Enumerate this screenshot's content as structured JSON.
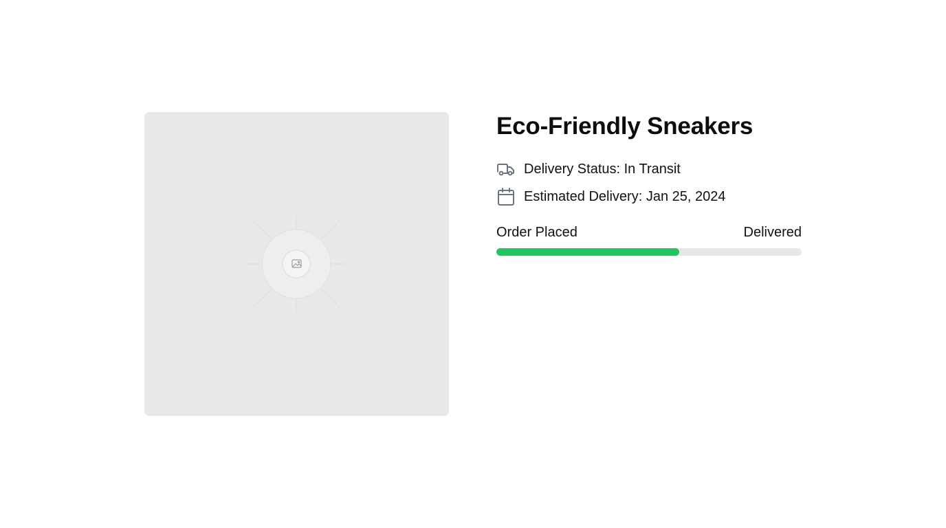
{
  "product": {
    "title": "Eco-Friendly Sneakers",
    "image_placeholder_icon": "image-icon"
  },
  "delivery": {
    "status_icon": "truck-icon",
    "status_text": "Delivery Status: In Transit",
    "estimate_icon": "calendar-icon",
    "estimate_text": "Estimated Delivery: Jan 25, 2024"
  },
  "progress": {
    "start_label": "Order Placed",
    "end_label": "Delivered",
    "value": 0.6,
    "fill_color": "#22c55e",
    "track_color": "#e5e7eb"
  }
}
